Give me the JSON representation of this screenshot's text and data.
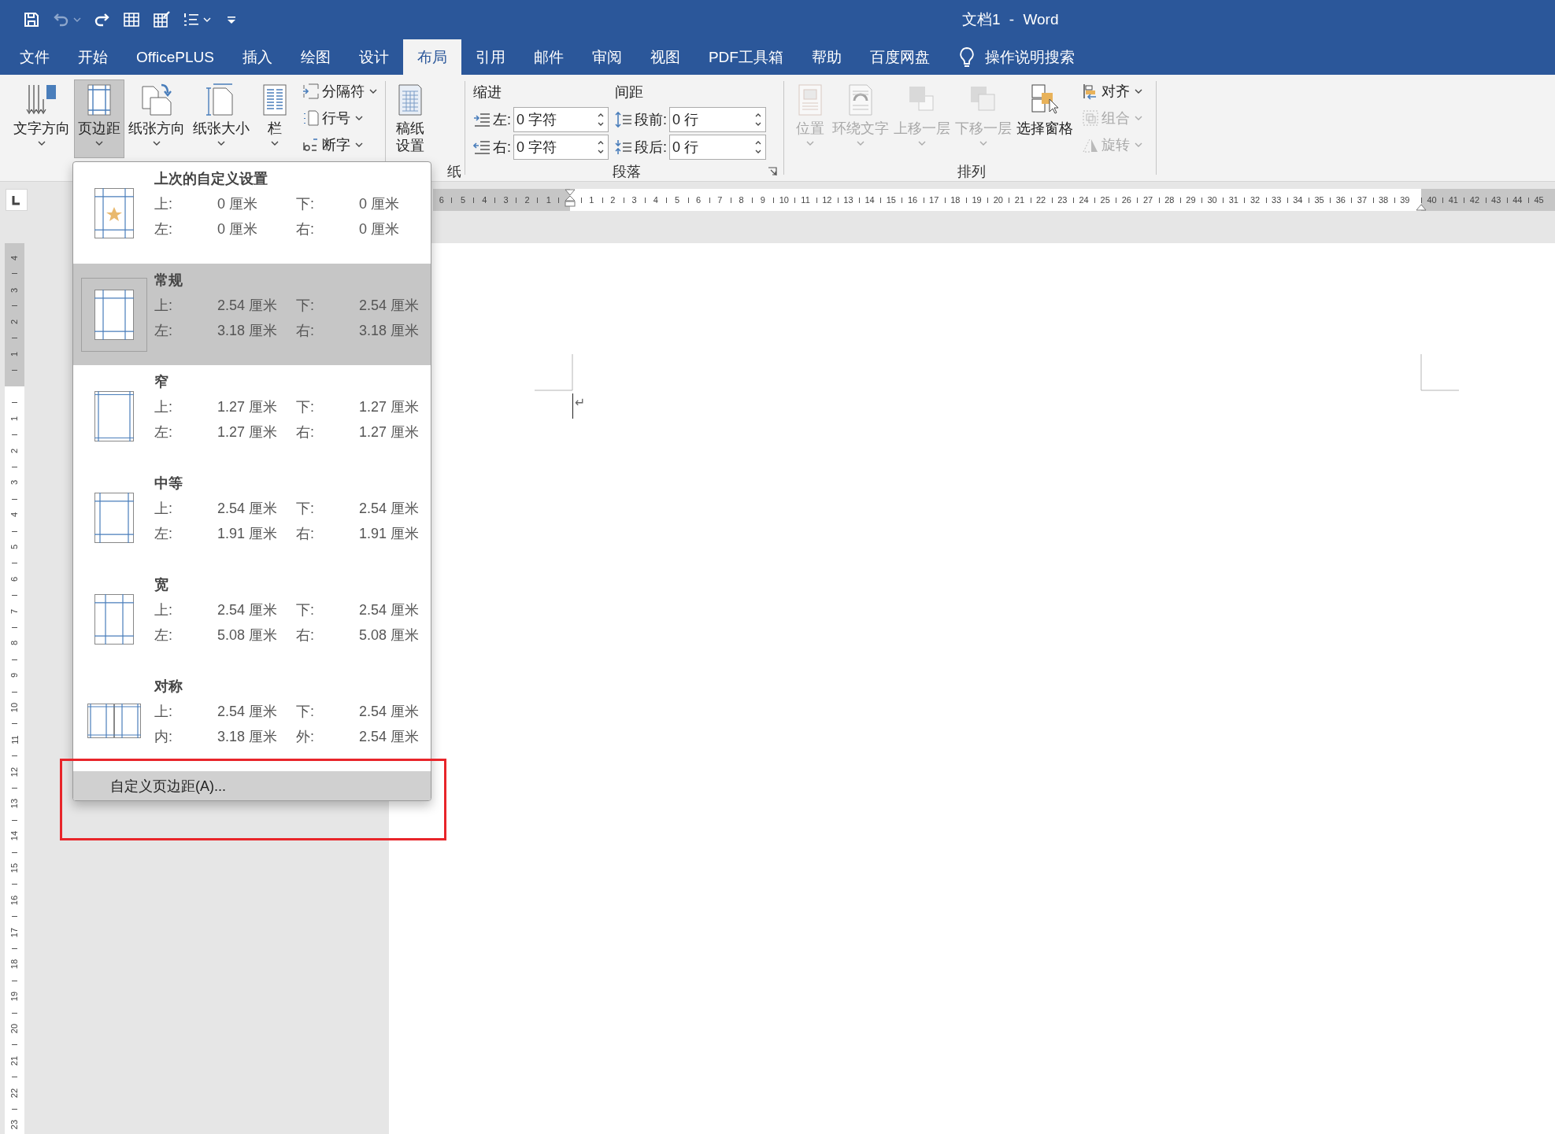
{
  "title_bar": {
    "title": "文档1 - Word",
    "quick_access": [
      {
        "kind": "save",
        "disabled": false,
        "has_menu": false
      },
      {
        "kind": "undo",
        "disabled": true,
        "has_menu": true
      },
      {
        "kind": "redo",
        "disabled": false,
        "has_menu": false
      },
      {
        "kind": "table-edit",
        "disabled": false,
        "has_menu": false
      },
      {
        "kind": "table-draw",
        "disabled": false,
        "has_menu": false
      },
      {
        "kind": "numbering",
        "disabled": false,
        "has_menu": true
      },
      {
        "kind": "customize",
        "disabled": false,
        "has_menu": false
      }
    ]
  },
  "tabs": [
    {
      "label": "文件",
      "selected": false
    },
    {
      "label": "开始",
      "selected": false
    },
    {
      "label": "OfficePLUS",
      "selected": false
    },
    {
      "label": "插入",
      "selected": false
    },
    {
      "label": "绘图",
      "selected": false
    },
    {
      "label": "设计",
      "selected": false
    },
    {
      "label": "布局",
      "selected": true
    },
    {
      "label": "引用",
      "selected": false
    },
    {
      "label": "邮件",
      "selected": false
    },
    {
      "label": "审阅",
      "selected": false
    },
    {
      "label": "视图",
      "selected": false
    },
    {
      "label": "PDF工具箱",
      "selected": false
    },
    {
      "label": "帮助",
      "selected": false
    },
    {
      "label": "百度网盘",
      "selected": false
    }
  ],
  "search": {
    "label": "操作说明搜索"
  },
  "page_setup": {
    "large_buttons": [
      {
        "label": "文字方向",
        "kind": "text-direction",
        "pressed": false
      },
      {
        "label": "页边距",
        "kind": "margins",
        "pressed": true
      },
      {
        "label": "纸张方向",
        "kind": "orientation",
        "pressed": false
      },
      {
        "label": "纸张大小",
        "kind": "size",
        "pressed": false
      },
      {
        "label": "栏",
        "kind": "columns",
        "pressed": false
      }
    ],
    "small_buttons": [
      {
        "label": "分隔符",
        "kind": "breaks"
      },
      {
        "label": "行号",
        "kind": "line-numbers"
      },
      {
        "label": "断字",
        "kind": "hyphenation"
      }
    ]
  },
  "manuscript": {
    "button": "稿纸设置",
    "group_label": "纸"
  },
  "paragraph": {
    "group_label": "段落",
    "indent_heading": "缩进",
    "spacing_heading": "间距",
    "fields": [
      {
        "kind": "indent-left",
        "label": "左:",
        "value": "0 字符"
      },
      {
        "kind": "space-before",
        "label": "段前:",
        "value": "0 行"
      },
      {
        "kind": "indent-right",
        "label": "右:",
        "value": "0 字符"
      },
      {
        "kind": "space-after",
        "label": "段后:",
        "value": "0 行"
      }
    ]
  },
  "arrange": {
    "group_label": "排列",
    "large_buttons": [
      {
        "label": "位置",
        "kind": "position",
        "disabled": true,
        "has_menu": true
      },
      {
        "label": "环绕文字",
        "kind": "wrap-text",
        "disabled": true,
        "has_menu": true
      },
      {
        "label": "上移一层",
        "kind": "bring-forward",
        "disabled": true,
        "has_menu": true
      },
      {
        "label": "下移一层",
        "kind": "send-backward",
        "disabled": true,
        "has_menu": true
      },
      {
        "label": "选择窗格",
        "kind": "selection-pane",
        "disabled": false,
        "has_menu": false
      }
    ],
    "small_buttons": [
      {
        "label": "对齐",
        "kind": "align",
        "disabled": false
      },
      {
        "label": "组合",
        "kind": "group",
        "disabled": true
      },
      {
        "label": "旋转",
        "kind": "rotate",
        "disabled": true
      }
    ]
  },
  "horizontal_ruler": {
    "left_numbers": [
      "6",
      "5",
      "4",
      "3",
      "2",
      "1"
    ],
    "numbers": [
      "1",
      "2",
      "3",
      "4",
      "5",
      "6",
      "7",
      "8",
      "9",
      "10",
      "11",
      "12",
      "13",
      "14",
      "15",
      "16",
      "17",
      "18",
      "19",
      "20",
      "21",
      "22",
      "23",
      "24",
      "25",
      "26",
      "27",
      "28",
      "29",
      "30",
      "31",
      "32",
      "33",
      "34",
      "35",
      "36",
      "37",
      "38",
      "39"
    ],
    "right_numbers": [
      "40",
      "41",
      "42",
      "43",
      "44",
      "45"
    ]
  },
  "vertical_ruler": {
    "top_numbers": [
      "4",
      "3",
      "2",
      "1"
    ],
    "numbers": [
      "1",
      "2",
      "3",
      "4",
      "5",
      "6",
      "7",
      "8",
      "9",
      "10",
      "11",
      "12",
      "13",
      "14",
      "15",
      "16",
      "17",
      "18",
      "19",
      "20",
      "21",
      "22",
      "23"
    ]
  },
  "document": {
    "paragraph_mark": "↵"
  },
  "margins_menu": {
    "presets": [
      {
        "name": "上次的自定义设置",
        "kind": "custom",
        "selected": false,
        "fields": [
          {
            "label": "上:",
            "value": "0 厘米"
          },
          {
            "label": "下:",
            "value": "0 厘米"
          },
          {
            "label": "左:",
            "value": "0 厘米"
          },
          {
            "label": "右:",
            "value": "0 厘米"
          }
        ]
      },
      {
        "name": "常规",
        "kind": "normal",
        "selected": true,
        "fields": [
          {
            "label": "上:",
            "value": "2.54 厘米"
          },
          {
            "label": "下:",
            "value": "2.54 厘米"
          },
          {
            "label": "左:",
            "value": "3.18 厘米"
          },
          {
            "label": "右:",
            "value": "3.18 厘米"
          }
        ]
      },
      {
        "name": "窄",
        "kind": "narrow",
        "selected": false,
        "fields": [
          {
            "label": "上:",
            "value": "1.27 厘米"
          },
          {
            "label": "下:",
            "value": "1.27 厘米"
          },
          {
            "label": "左:",
            "value": "1.27 厘米"
          },
          {
            "label": "右:",
            "value": "1.27 厘米"
          }
        ]
      },
      {
        "name": "中等",
        "kind": "moderate",
        "selected": false,
        "fields": [
          {
            "label": "上:",
            "value": "2.54 厘米"
          },
          {
            "label": "下:",
            "value": "2.54 厘米"
          },
          {
            "label": "左:",
            "value": "1.91 厘米"
          },
          {
            "label": "右:",
            "value": "1.91 厘米"
          }
        ]
      },
      {
        "name": "宽",
        "kind": "wide",
        "selected": false,
        "fields": [
          {
            "label": "上:",
            "value": "2.54 厘米"
          },
          {
            "label": "下:",
            "value": "2.54 厘米"
          },
          {
            "label": "左:",
            "value": "5.08 厘米"
          },
          {
            "label": "右:",
            "value": "5.08 厘米"
          }
        ]
      },
      {
        "name": "对称",
        "kind": "mirrored",
        "selected": false,
        "fields": [
          {
            "label": "上:",
            "value": "2.54 厘米"
          },
          {
            "label": "下:",
            "value": "2.54 厘米"
          },
          {
            "label": "内:",
            "value": "3.18 厘米"
          },
          {
            "label": "外:",
            "value": "2.54 厘米"
          }
        ]
      }
    ],
    "footer": "自定义页边距(A)..."
  }
}
